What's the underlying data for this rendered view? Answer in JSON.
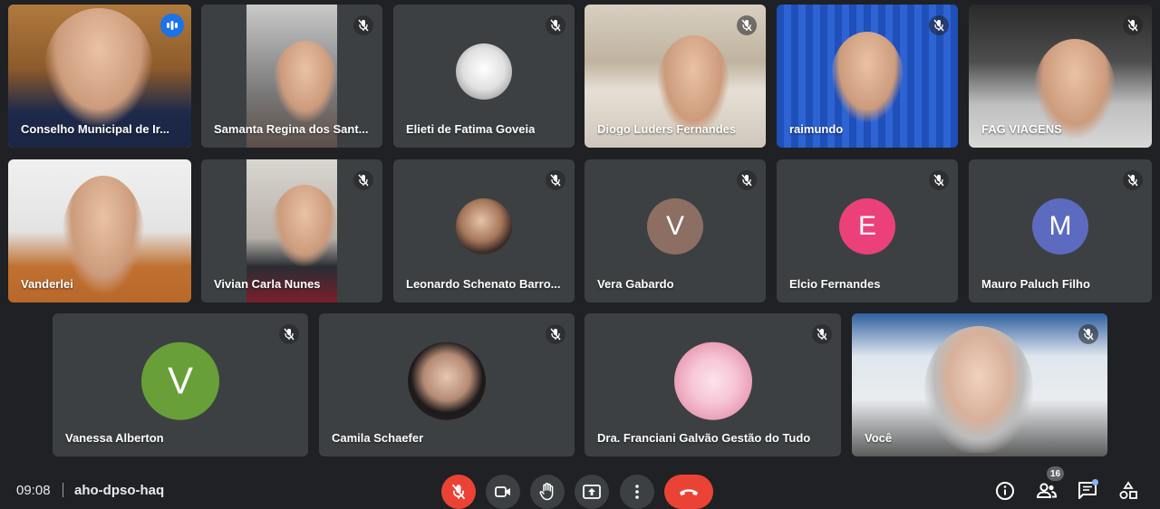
{
  "meeting": {
    "time": "09:08",
    "code": "aho-dpso-haq",
    "participants_count": "16"
  },
  "participants": [
    {
      "name": "Conselho Municipal de Ir...",
      "state": "speaking"
    },
    {
      "name": "Samanta Regina dos Sant...",
      "state": "muted"
    },
    {
      "name": "Elieti de Fatima Goveia",
      "state": "muted"
    },
    {
      "name": "Diogo Luders Fernandes",
      "state": "muted"
    },
    {
      "name": "raimundo",
      "state": "muted"
    },
    {
      "name": "FAG VIAGENS",
      "state": "muted"
    },
    {
      "name": "Vanderlei",
      "state": "none"
    },
    {
      "name": "Vivian Carla Nunes",
      "state": "muted"
    },
    {
      "name": "Leonardo Schenato Barro...",
      "state": "muted"
    },
    {
      "name": "Vera Gabardo",
      "state": "muted",
      "initial": "V",
      "color": "#8d6e63"
    },
    {
      "name": "Elcio Fernandes",
      "state": "muted",
      "initial": "E",
      "color": "#ec407a"
    },
    {
      "name": "Mauro Paluch Filho",
      "state": "muted",
      "initial": "M",
      "color": "#5c6bc0"
    },
    {
      "name": "Vanessa Alberton",
      "state": "muted",
      "initial": "V",
      "color": "#689f38"
    },
    {
      "name": "Camila Schaefer",
      "state": "muted"
    },
    {
      "name": "Dra. Franciani Galvão Gestão do Tudo",
      "state": "muted"
    },
    {
      "name": "Você",
      "state": "muted"
    }
  ],
  "colors": {
    "background": "#202124",
    "tile": "#3c4043",
    "accent": "#8ab4f8",
    "danger": "#ea4335"
  },
  "icons": [
    "mic-off-icon",
    "camera-icon",
    "raise-hand-icon",
    "present-icon",
    "more-options-icon",
    "hang-up-icon",
    "info-icon",
    "people-icon",
    "chat-icon",
    "activities-icon"
  ]
}
